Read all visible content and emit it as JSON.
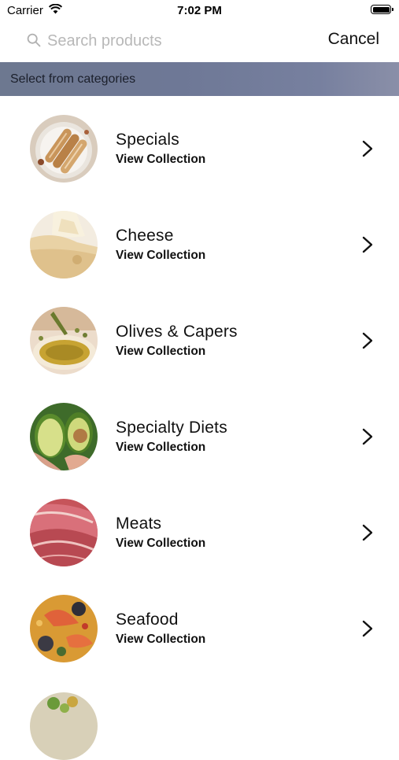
{
  "status_bar": {
    "carrier": "Carrier",
    "time": "7:02 PM"
  },
  "search": {
    "placeholder": "Search products",
    "value": "",
    "cancel_label": "Cancel"
  },
  "category_header": "Select from categories",
  "categories": [
    {
      "title": "Specials",
      "subtitle": "View Collection",
      "image": "pastry-rolls-on-plate"
    },
    {
      "title": "Cheese",
      "subtitle": "View Collection",
      "image": "cheese-wedge"
    },
    {
      "title": "Olives & Capers",
      "subtitle": "View Collection",
      "image": "olive-oil-bowl"
    },
    {
      "title": "Specialty Diets",
      "subtitle": "View Collection",
      "image": "avocado-halves"
    },
    {
      "title": "Meats",
      "subtitle": "View Collection",
      "image": "sliced-cured-ham"
    },
    {
      "title": "Seafood",
      "subtitle": "View Collection",
      "image": "paella-with-shrimp"
    }
  ],
  "icons": {
    "search": "search-icon",
    "chevron": "chevron-right-icon",
    "wifi": "wifi-icon",
    "battery": "battery-icon"
  }
}
